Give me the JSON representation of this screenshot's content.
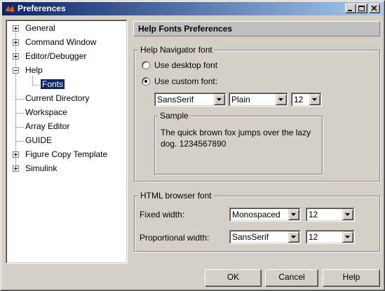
{
  "window": {
    "title": "Preferences"
  },
  "tree": {
    "items": [
      {
        "label": "General",
        "expander": "+"
      },
      {
        "label": "Command Window",
        "expander": "+"
      },
      {
        "label": "Editor/Debugger",
        "expander": "+"
      },
      {
        "label": "Help",
        "expander": "-"
      },
      {
        "label": "Fonts",
        "expander": "",
        "selected": true
      },
      {
        "label": "Current Directory",
        "expander": ""
      },
      {
        "label": "Workspace",
        "expander": ""
      },
      {
        "label": "Array Editor",
        "expander": ""
      },
      {
        "label": "GUIDE",
        "expander": ""
      },
      {
        "label": "Figure Copy Template",
        "expander": "+"
      },
      {
        "label": "Simulink",
        "expander": "+"
      }
    ]
  },
  "panel": {
    "header": "Help Fonts Preferences",
    "navigator": {
      "title": "Help Navigator font",
      "desktop_label": "Use desktop font",
      "custom_label": "Use custom font:",
      "selected": "custom",
      "font_name": "SansSerif",
      "font_style": "Plain",
      "font_size": "12",
      "sample_title": "Sample",
      "sample_text": "The quick brown fox jumps over the lazy dog. 1234567890"
    },
    "browser": {
      "title": "HTML browser font",
      "fixed_label": "Fixed width:",
      "fixed_font": "Monospaced",
      "fixed_size": "12",
      "prop_label": "Proportional width:",
      "prop_font": "SansSerif",
      "prop_size": "12"
    }
  },
  "buttons": {
    "ok": "OK",
    "cancel": "Cancel",
    "help": "Help"
  },
  "colors": {
    "title_start": "#0a246a",
    "title_end": "#a6caf0",
    "selection": "#0a246a"
  }
}
